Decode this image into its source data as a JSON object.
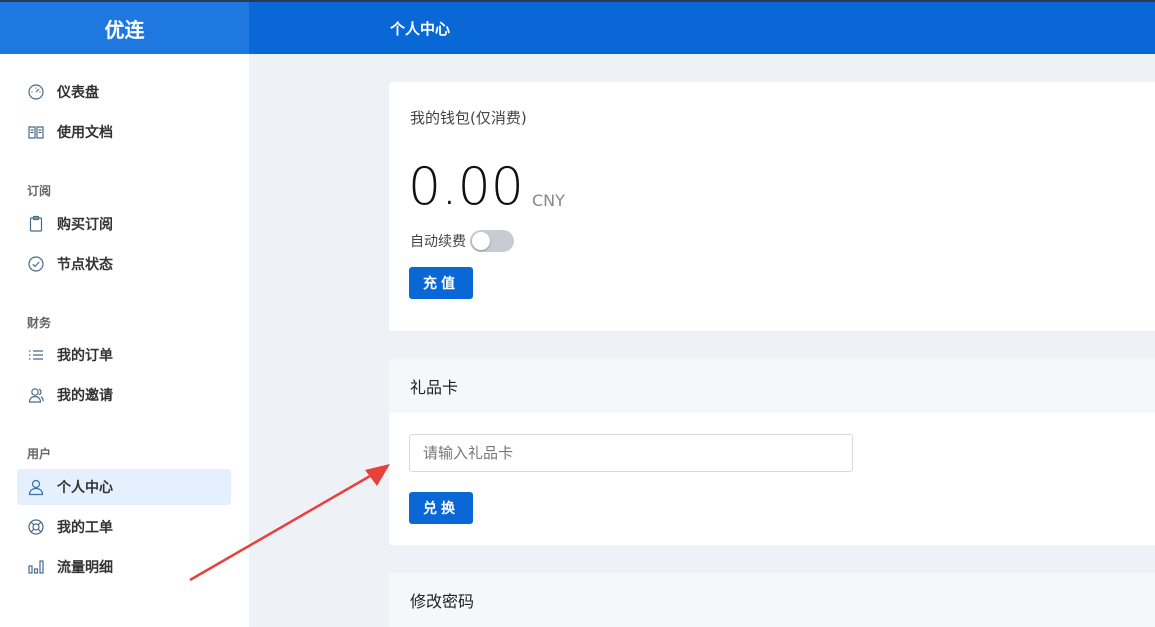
{
  "header": {
    "brand": "优连",
    "page_title": "个人中心"
  },
  "sidebar": {
    "items_top": [
      {
        "label": "仪表盘",
        "icon": "dashboard-icon"
      },
      {
        "label": "使用文档",
        "icon": "book-icon"
      }
    ],
    "sections": [
      {
        "label": "订阅",
        "items": [
          {
            "label": "购买订阅",
            "icon": "clipboard-icon"
          },
          {
            "label": "节点状态",
            "icon": "check-circle-icon"
          }
        ]
      },
      {
        "label": "财务",
        "items": [
          {
            "label": "我的订单",
            "icon": "list-icon"
          },
          {
            "label": "我的邀请",
            "icon": "users-icon"
          }
        ]
      },
      {
        "label": "用户",
        "items": [
          {
            "label": "个人中心",
            "icon": "user-icon",
            "active": true
          },
          {
            "label": "我的工单",
            "icon": "lifebuoy-icon"
          },
          {
            "label": "流量明细",
            "icon": "bar-chart-icon"
          }
        ]
      }
    ]
  },
  "wallet": {
    "title": "我的钱包(仅消费)",
    "amount": "0.00",
    "currency": "CNY",
    "auto_renew_label": "自动续费",
    "auto_renew_on": false,
    "recharge_label": "充值"
  },
  "gift_card": {
    "title": "礼品卡",
    "placeholder": "请输入礼品卡",
    "value": "",
    "redeem_label": "兑换"
  },
  "password": {
    "title": "修改密码"
  },
  "colors": {
    "primary": "#0968d6",
    "brand_bg": "#1f78df",
    "active_bg": "#e4f0fd",
    "annotation_arrow": "#e8403a"
  }
}
